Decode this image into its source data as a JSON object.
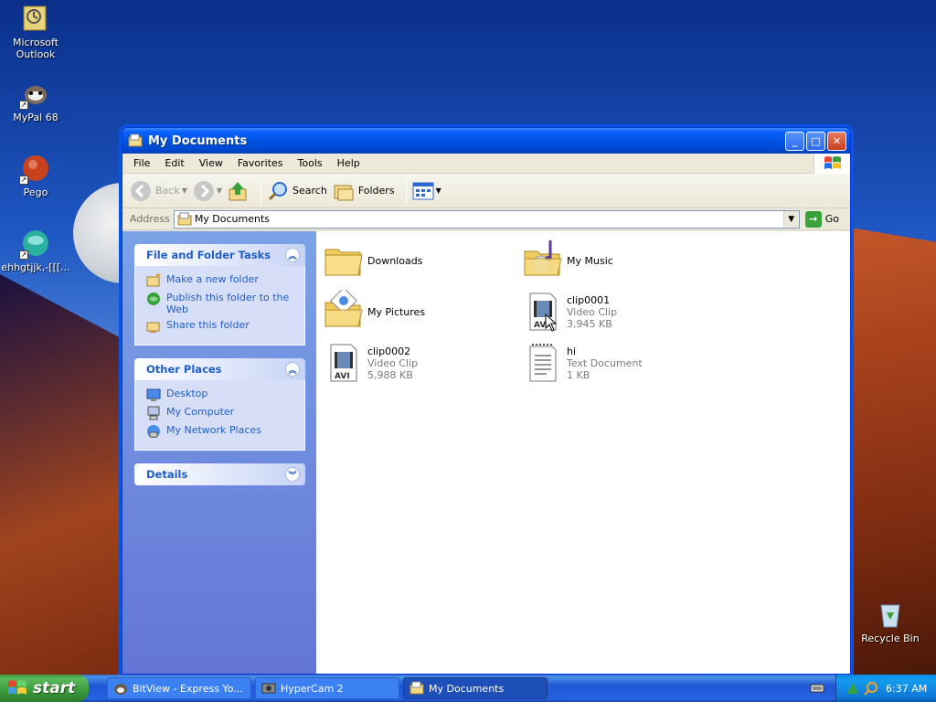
{
  "desktop": {
    "icons": [
      {
        "label": "Microsoft Outlook",
        "icon": "outlook-icon"
      },
      {
        "label": "MyPal 68",
        "icon": "mypal-icon"
      },
      {
        "label": "Pego",
        "icon": "pego-icon"
      },
      {
        "label": "ehhgtjjk,-[[[...",
        "icon": "generic-app-icon"
      },
      {
        "label": "Recycle Bin",
        "icon": "recycle-bin-icon"
      }
    ]
  },
  "window": {
    "title": "My Documents",
    "menu": [
      "File",
      "Edit",
      "View",
      "Favorites",
      "Tools",
      "Help"
    ],
    "toolbar": {
      "back": "Back",
      "search": "Search",
      "folders": "Folders"
    },
    "address": {
      "label": "Address",
      "value": "My Documents",
      "go": "Go"
    },
    "taskpane": {
      "file_tasks": {
        "title": "File and Folder Tasks",
        "items": [
          "Make a new folder",
          "Publish this folder to the Web",
          "Share this folder"
        ]
      },
      "other_places": {
        "title": "Other Places",
        "items": [
          "Desktop",
          "My Computer",
          "My Network Places"
        ]
      },
      "details": {
        "title": "Details"
      }
    },
    "files": [
      {
        "name": "Downloads",
        "type": "",
        "size": "",
        "icon": "folder-icon"
      },
      {
        "name": "My Music",
        "type": "",
        "size": "",
        "icon": "music-folder-icon"
      },
      {
        "name": "My Pictures",
        "type": "",
        "size": "",
        "icon": "pictures-folder-icon"
      },
      {
        "name": "clip0001",
        "type": "Video Clip",
        "size": "3,945 KB",
        "icon": "avi-file-icon"
      },
      {
        "name": "clip0002",
        "type": "Video Clip",
        "size": "5,988 KB",
        "icon": "avi-file-icon"
      },
      {
        "name": "hi",
        "type": "Text Document",
        "size": "1 KB",
        "icon": "text-file-icon"
      }
    ]
  },
  "taskbar": {
    "start": "start",
    "tasks": [
      {
        "label": "BitView - Express Yo...",
        "active": false
      },
      {
        "label": "HyperCam 2",
        "active": false
      },
      {
        "label": "My Documents",
        "active": true
      }
    ],
    "clock": "6:37 AM"
  },
  "colors": {
    "title_blue": "#0054e3",
    "taskpane_blue": "#6375d6",
    "link_blue": "#215dc6",
    "start_green": "#3a9a3a"
  }
}
